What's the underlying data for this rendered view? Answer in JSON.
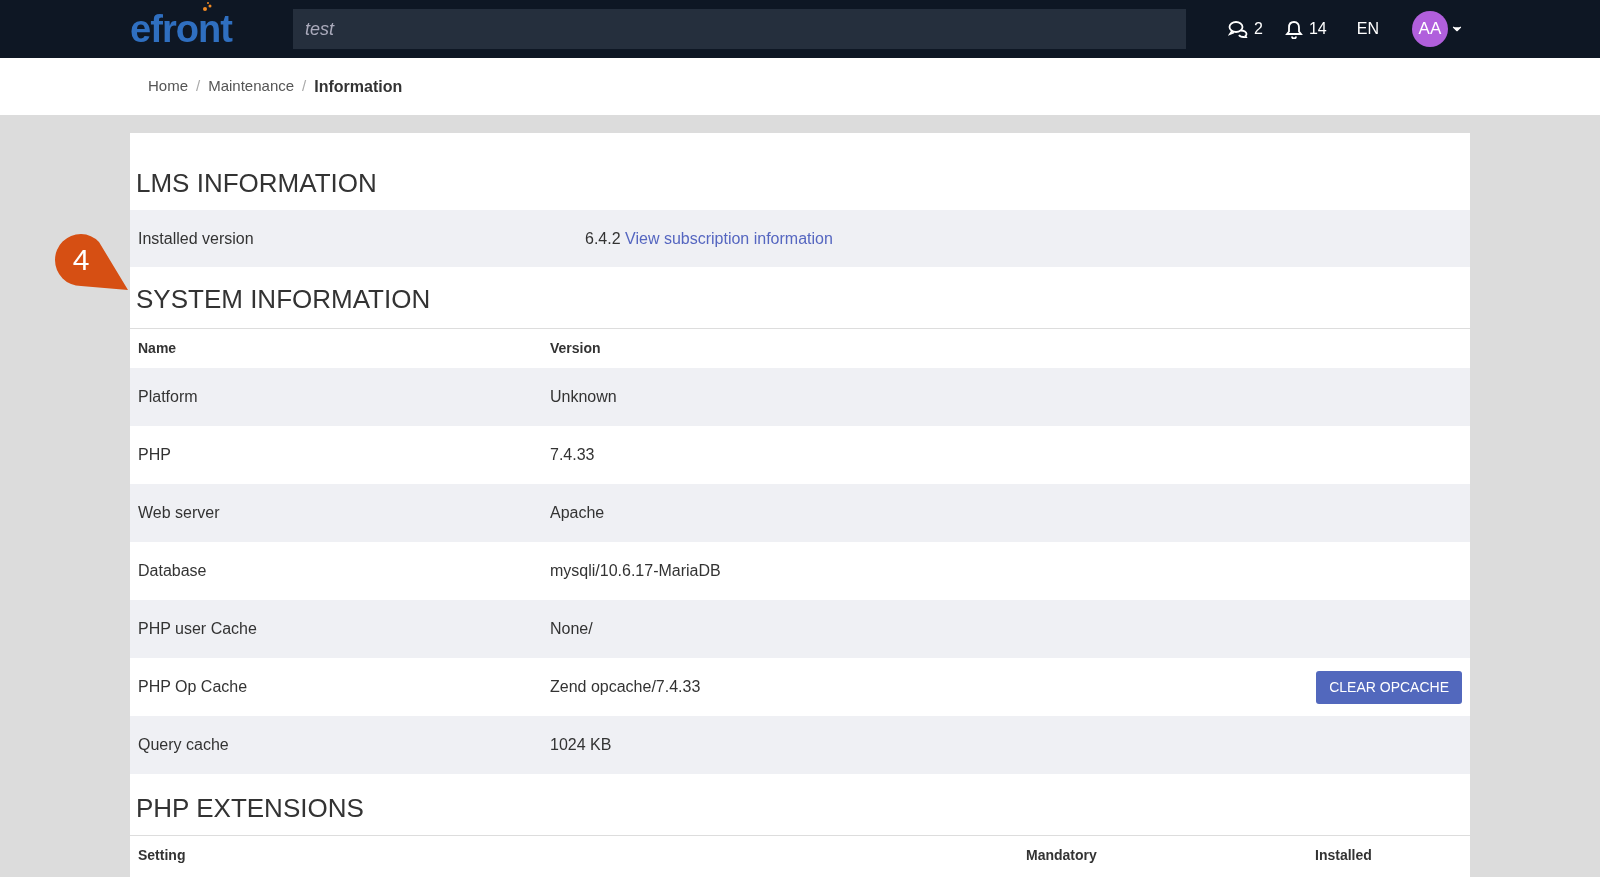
{
  "header": {
    "logo": "efront",
    "search": {
      "value": "test"
    },
    "messages": "2",
    "notifications": "14",
    "language": "EN",
    "avatar": "AA"
  },
  "breadcrumb_separator": "/",
  "breadcrumb": [
    {
      "label": "Home",
      "current": false
    },
    {
      "label": "Maintenance",
      "current": false
    },
    {
      "label": "Information",
      "current": true
    }
  ],
  "callout": "4",
  "lms": {
    "title": "LMS INFORMATION",
    "rows": [
      {
        "label": "Installed version",
        "value": "6.4.2",
        "link": "View subscription information"
      }
    ]
  },
  "system": {
    "title": "SYSTEM INFORMATION",
    "columns": [
      "Name",
      "Version"
    ],
    "rows": [
      {
        "name": "Platform",
        "version": "Unknown"
      },
      {
        "name": "PHP",
        "version": "7.4.33"
      },
      {
        "name": "Web server",
        "version": "Apache"
      },
      {
        "name": "Database",
        "version": "mysqli/10.6.17-MariaDB"
      },
      {
        "name": "PHP user Cache",
        "version": "None/"
      },
      {
        "name": "PHP Op Cache",
        "version": "Zend opcache/7.4.33",
        "action": "CLEAR OPCACHE"
      },
      {
        "name": "Query cache",
        "version": "1024 KB"
      }
    ]
  },
  "extensions": {
    "title": "PHP EXTENSIONS",
    "columns": [
      "Setting",
      "Mandatory",
      "Installed"
    ]
  }
}
